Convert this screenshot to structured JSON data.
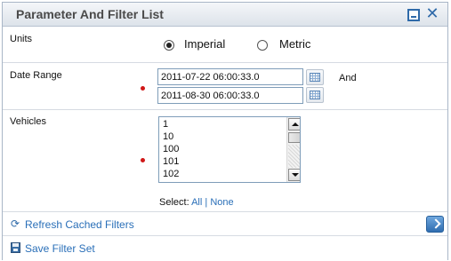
{
  "panel": {
    "title": "Parameter And Filter List",
    "minimize_icon": "minimize-icon",
    "close_icon": "close-icon"
  },
  "units": {
    "label": "Units",
    "options": [
      {
        "label": "Imperial",
        "selected": true
      },
      {
        "label": "Metric",
        "selected": false
      }
    ]
  },
  "date_range": {
    "label": "Date Range",
    "start": "2011-07-22 06:00:33.0",
    "end": "2011-08-30 06:00:33.0",
    "and_label": "And",
    "required_color": "#d01818"
  },
  "vehicles": {
    "label": "Vehicles",
    "items": [
      "1",
      "10",
      "100",
      "101",
      "102"
    ],
    "select_label": "Select:",
    "select_all": "All",
    "separator": "|",
    "select_none": "None"
  },
  "footer": {
    "refresh_label": "Refresh Cached Filters",
    "save_label": "Save Filter Set",
    "link_color": "#2a6fb8"
  }
}
